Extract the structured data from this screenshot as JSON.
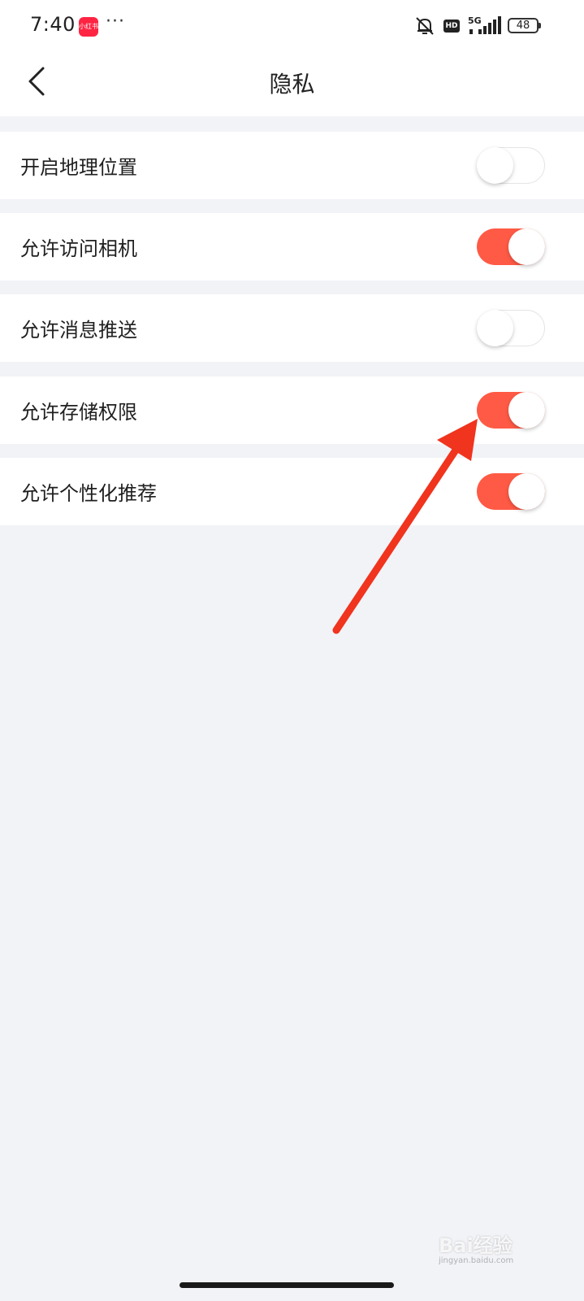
{
  "status_bar": {
    "time": "7:40",
    "app_badge": "小红书",
    "more": "···",
    "hd": "HD",
    "network": "5G",
    "battery": "48"
  },
  "header": {
    "title": "隐私",
    "back_icon": "chevron-left-icon"
  },
  "settings": [
    {
      "label": "开启地理位置",
      "enabled": false
    },
    {
      "label": "允许访问相机",
      "enabled": true
    },
    {
      "label": "允许消息推送",
      "enabled": false
    },
    {
      "label": "允许存储权限",
      "enabled": true
    },
    {
      "label": "允许个性化推荐",
      "enabled": true
    }
  ],
  "watermark": {
    "text": "Bai经验",
    "sub": "jingyan.baidu.com"
  },
  "colors": {
    "accent": "#ff5a45",
    "annotation_arrow": "#f0341e",
    "background": "#f2f3f7"
  }
}
